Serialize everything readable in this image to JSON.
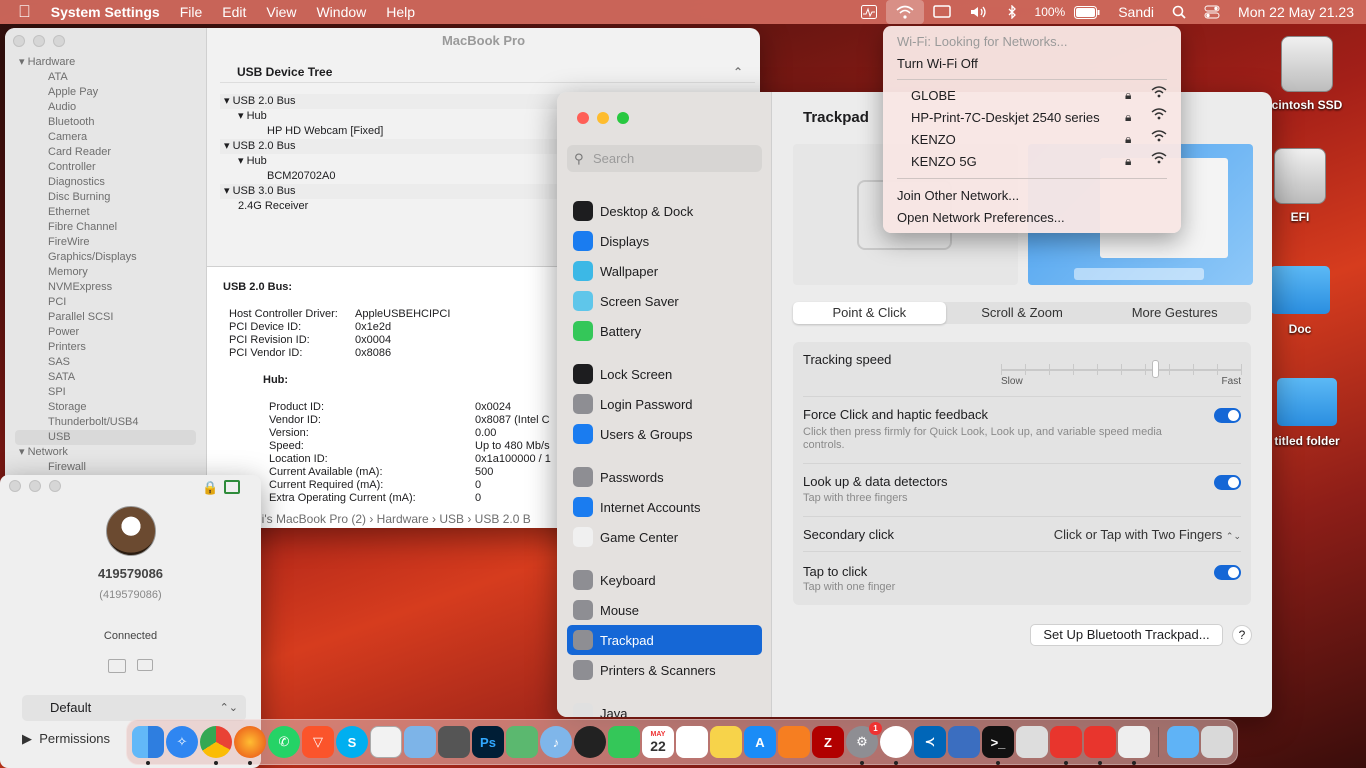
{
  "menubar": {
    "app": "System Settings",
    "items": [
      "File",
      "Edit",
      "View",
      "Window",
      "Help"
    ],
    "battery": "100%",
    "user": "Sandi",
    "datetime": "Mon 22 May  21.23"
  },
  "sysinfo": {
    "title": "MacBook Pro",
    "tree_header": "USB Device Tree",
    "sidebar": {
      "hardware_label": "Hardware",
      "items": [
        "ATA",
        "Apple Pay",
        "Audio",
        "Bluetooth",
        "Camera",
        "Card Reader",
        "Controller",
        "Diagnostics",
        "Disc Burning",
        "Ethernet",
        "Fibre Channel",
        "FireWire",
        "Graphics/Displays",
        "Memory",
        "NVMExpress",
        "PCI",
        "Parallel SCSI",
        "Power",
        "Printers",
        "SAS",
        "SATA",
        "SPI",
        "Storage",
        "Thunderbolt/USB4",
        "USB"
      ],
      "network_label": "Network",
      "network_items": [
        "Firewall"
      ]
    },
    "tree": [
      "USB 2.0 Bus",
      "Hub",
      "HP HD Webcam [Fixed]",
      "USB 2.0 Bus",
      "Hub",
      "BCM20702A0",
      "USB 3.0 Bus",
      "2.4G Receiver"
    ],
    "detail": {
      "heading": "USB 2.0 Bus:",
      "fields": [
        [
          "Host Controller Driver:",
          "AppleUSBEHCIPCI"
        ],
        [
          "PCI Device ID:",
          "0x1e2d"
        ],
        [
          "PCI Revision ID:",
          "0x0004"
        ],
        [
          "PCI Vendor ID:",
          "0x8086"
        ]
      ],
      "hub": "Hub:",
      "hub_fields": [
        [
          "Product ID:",
          "0x0024"
        ],
        [
          "Vendor ID:",
          "0x8087  (Intel C"
        ],
        [
          "Version:",
          "0.00"
        ],
        [
          "Speed:",
          "Up to 480 Mb/s"
        ],
        [
          "Location ID:",
          "0x1a100000 / 1"
        ],
        [
          "Current Available (mA):",
          "500"
        ],
        [
          "Current Required (mA):",
          "0"
        ],
        [
          "Extra Operating Current (mA):",
          "0"
        ]
      ]
    },
    "breadcrumb": "di's MacBook Pro (2)  ›  Hardware  ›  USB  ›  USB 2.0 B"
  },
  "contact": {
    "name": "419579086",
    "sub": "(419579086)",
    "status": "Connected",
    "select": "Default",
    "permissions": "Permissions"
  },
  "settings": {
    "search_placeholder": "Search",
    "title": "Trackpad",
    "nav": [
      {
        "label": "Desktop & Dock",
        "icon": "desktop-dock-icon",
        "color": "#1d1d1f"
      },
      {
        "label": "Displays",
        "icon": "displays-icon",
        "color": "#1a7cf0"
      },
      {
        "label": "Wallpaper",
        "icon": "wallpaper-icon",
        "color": "#3cb8e6"
      },
      {
        "label": "Screen Saver",
        "icon": "screen-saver-icon",
        "color": "#5fc6ea"
      },
      {
        "label": "Battery",
        "icon": "battery-icon",
        "color": "#34c759"
      },
      {
        "label": "Lock Screen",
        "icon": "lock-screen-icon",
        "color": "#1d1d1f"
      },
      {
        "label": "Login Password",
        "icon": "login-password-icon",
        "color": "#8e8e93"
      },
      {
        "label": "Users & Groups",
        "icon": "users-groups-icon",
        "color": "#1a7cf0"
      },
      {
        "label": "Passwords",
        "icon": "passwords-icon",
        "color": "#8e8e93"
      },
      {
        "label": "Internet Accounts",
        "icon": "internet-accounts-icon",
        "color": "#1a7cf0"
      },
      {
        "label": "Game Center",
        "icon": "game-center-icon",
        "color": "#f0f0f0"
      },
      {
        "label": "Keyboard",
        "icon": "keyboard-icon",
        "color": "#8e8e93"
      },
      {
        "label": "Mouse",
        "icon": "mouse-icon",
        "color": "#8e8e93"
      },
      {
        "label": "Trackpad",
        "icon": "trackpad-icon",
        "color": "#8e8e93"
      },
      {
        "label": "Printers & Scanners",
        "icon": "printers-scanners-icon",
        "color": "#8e8e93"
      },
      {
        "label": "Java",
        "icon": "java-icon",
        "color": "#e0e0e0"
      }
    ],
    "tabs": [
      "Point & Click",
      "Scroll & Zoom",
      "More Gestures"
    ],
    "tracking_label": "Tracking speed",
    "slow": "Slow",
    "fast": "Fast",
    "tracking_value": 0.64,
    "force_click": "Force Click and haptic feedback",
    "force_click_sub": "Click then press firmly for Quick Look, Look up, and variable speed media controls.",
    "lookup": "Look up & data detectors",
    "lookup_sub": "Tap with three fingers",
    "secondary": "Secondary click",
    "secondary_value": "Click or Tap with Two Fingers",
    "tap": "Tap to click",
    "tap_sub": "Tap with one finger",
    "setup_btn": "Set Up Bluetooth Trackpad...",
    "help": "?"
  },
  "wifi": {
    "status": "Wi-Fi: Looking for Networks...",
    "toggle": "Turn Wi-Fi Off",
    "networks": [
      "GLOBE",
      "HP-Print-7C-Deskjet 2540 series",
      "KENZO",
      "KENZO 5G"
    ],
    "join": "Join Other Network...",
    "prefs": "Open Network Preferences..."
  },
  "desktop": [
    "cintosh SSD",
    "EFI",
    "Doc",
    "titled folder"
  ],
  "dock": {
    "calendar_month": "MAY",
    "calendar_day": "22",
    "badge": "1"
  }
}
